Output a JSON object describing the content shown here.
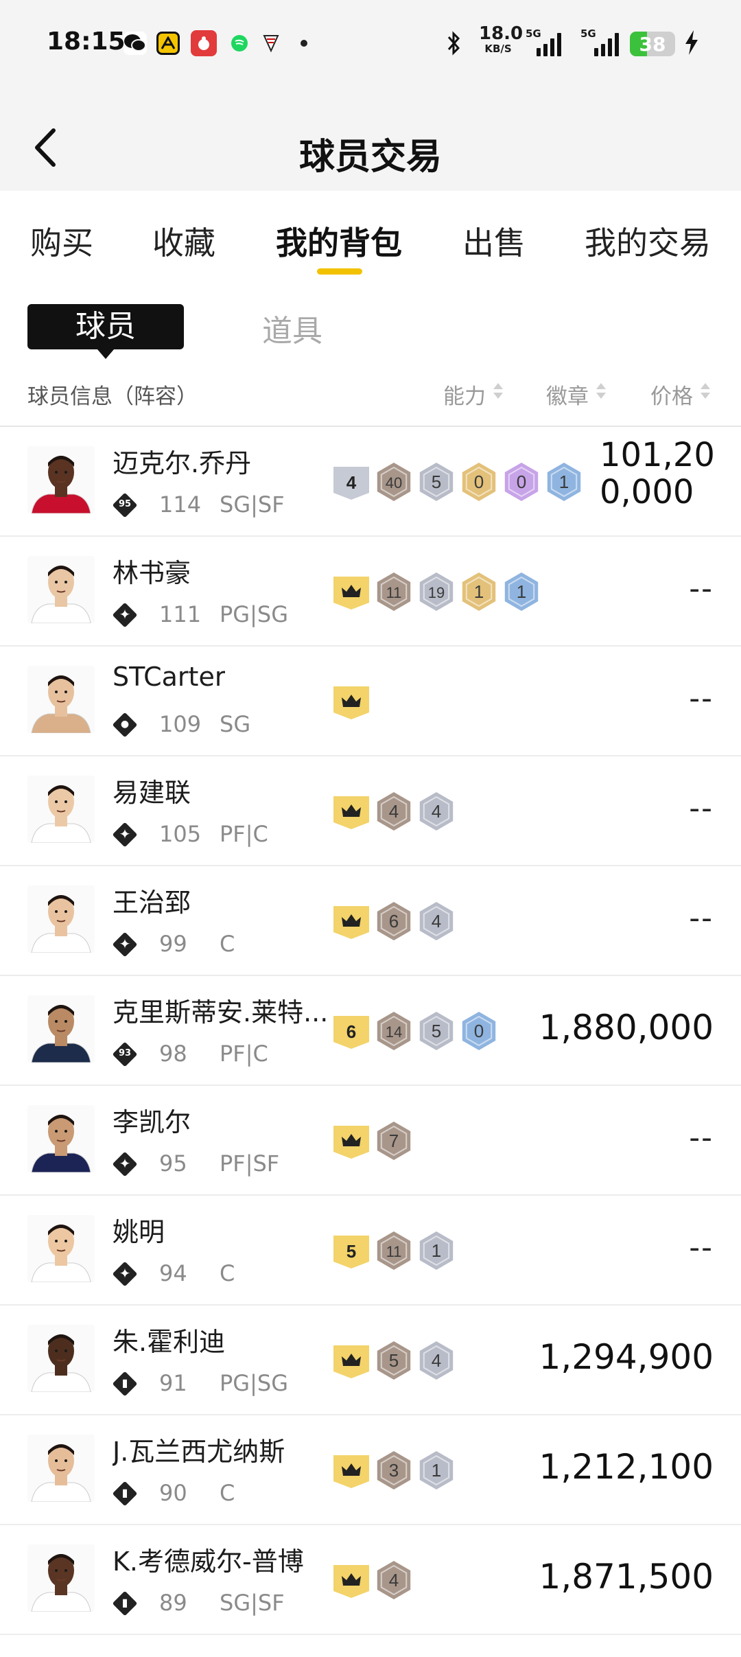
{
  "status": {
    "time": "18:15",
    "speed_value": "18.0",
    "speed_unit": "KB/S",
    "net1": "5G",
    "net2": "5G",
    "battery": "38",
    "battery_pct": 0.38
  },
  "header": {
    "title": "球员交易"
  },
  "tabs": [
    {
      "label": "购买"
    },
    {
      "label": "收藏"
    },
    {
      "label": "我的背包",
      "active": true
    },
    {
      "label": "出售"
    },
    {
      "label": "我的交易"
    }
  ],
  "subtabs": {
    "players": "球员",
    "items": "道具"
  },
  "columns": {
    "info": "球员信息（阵容）",
    "ability": "能力",
    "badge": "徽章",
    "price": "价格"
  },
  "colors": {
    "accent": "#f2c200",
    "gold_badge": "#f3d36a",
    "bronze": "#a8968a",
    "silver": "#b8bcc8",
    "gold": "#e3c17a",
    "purple": "#c7a3e8",
    "blue": "#8fb4e0"
  },
  "players": [
    {
      "name": "迈克尔.乔丹",
      "ovr": "114",
      "pos": "SG|SF",
      "rank_icon": "95",
      "skin": "#5a3322",
      "jersey": "#c8102e",
      "badges": [
        {
          "kind": "silver-flat",
          "label": "4"
        },
        {
          "kind": "bronze",
          "label": "40"
        },
        {
          "kind": "silver",
          "label": "5"
        },
        {
          "kind": "gold",
          "label": "0"
        },
        {
          "kind": "purple",
          "label": "0"
        },
        {
          "kind": "blue",
          "label": "1"
        }
      ],
      "price": "101,200,000"
    },
    {
      "name": "林书豪",
      "ovr": "111",
      "pos": "PG|SG",
      "rank_icon": "star",
      "skin": "#e9c6a4",
      "jersey": "#ffffff",
      "badges": [
        {
          "kind": "crown"
        },
        {
          "kind": "bronze",
          "label": "11"
        },
        {
          "kind": "silver",
          "label": "19"
        },
        {
          "kind": "gold",
          "label": "1"
        },
        {
          "kind": "blue",
          "label": "1"
        }
      ],
      "price": "--"
    },
    {
      "name": "STCarter",
      "ovr": "109",
      "pos": "SG",
      "rank_icon": "person",
      "skin": "#e7c19e",
      "jersey": "#d9b08a",
      "badges": [
        {
          "kind": "crown"
        }
      ],
      "price": "--"
    },
    {
      "name": "易建联",
      "ovr": "105",
      "pos": "PF|C",
      "rank_icon": "star",
      "skin": "#ecc9a6",
      "jersey": "#ffffff",
      "badges": [
        {
          "kind": "crown"
        },
        {
          "kind": "bronze",
          "label": "4"
        },
        {
          "kind": "silver",
          "label": "4"
        }
      ],
      "price": "--"
    },
    {
      "name": "王治郅",
      "ovr": "99",
      "pos": "C",
      "rank_icon": "star",
      "skin": "#e9c3a0",
      "jersey": "#ffffff",
      "badges": [
        {
          "kind": "crown"
        },
        {
          "kind": "bronze",
          "label": "6"
        },
        {
          "kind": "silver",
          "label": "4"
        }
      ],
      "price": "--"
    },
    {
      "name": "克里斯蒂安.莱特...",
      "ovr": "98",
      "pos": "PF|C",
      "rank_icon": "93",
      "skin": "#b98a64",
      "jersey": "#1c2c4a",
      "badges": [
        {
          "kind": "gold-flat",
          "label": "6"
        },
        {
          "kind": "bronze",
          "label": "14"
        },
        {
          "kind": "silver",
          "label": "5"
        },
        {
          "kind": "blue",
          "label": "0"
        }
      ],
      "price": "1,880,000"
    },
    {
      "name": "李凯尔",
      "ovr": "95",
      "pos": "PF|SF",
      "rank_icon": "star",
      "skin": "#c99a74",
      "jersey": "#1c2456",
      "badges": [
        {
          "kind": "crown"
        },
        {
          "kind": "bronze",
          "label": "7"
        }
      ],
      "price": "--"
    },
    {
      "name": "姚明",
      "ovr": "94",
      "pos": "C",
      "rank_icon": "star",
      "skin": "#ecc7a2",
      "jersey": "#ffffff",
      "badges": [
        {
          "kind": "gold-flat",
          "label": "5"
        },
        {
          "kind": "bronze",
          "label": "11"
        },
        {
          "kind": "silver",
          "label": "1"
        }
      ],
      "price": "--"
    },
    {
      "name": "朱.霍利迪",
      "ovr": "91",
      "pos": "PG|SG",
      "rank_icon": "bars",
      "skin": "#4d2e1e",
      "jersey": "#ffffff",
      "badges": [
        {
          "kind": "crown"
        },
        {
          "kind": "bronze",
          "label": "5"
        },
        {
          "kind": "silver",
          "label": "4"
        }
      ],
      "price": "1,294,900"
    },
    {
      "name": "J.瓦兰西尤纳斯",
      "ovr": "90",
      "pos": "C",
      "rank_icon": "bars",
      "skin": "#e6bd99",
      "jersey": "#ffffff",
      "badges": [
        {
          "kind": "crown"
        },
        {
          "kind": "bronze",
          "label": "3"
        },
        {
          "kind": "silver",
          "label": "1"
        }
      ],
      "price": "1,212,100"
    },
    {
      "name": "K.考德威尔-普博",
      "ovr": "89",
      "pos": "SG|SF",
      "rank_icon": "bars",
      "skin": "#5a3524",
      "jersey": "#ffffff",
      "badges": [
        {
          "kind": "crown"
        },
        {
          "kind": "bronze",
          "label": "4"
        }
      ],
      "price": "1,871,500"
    }
  ]
}
